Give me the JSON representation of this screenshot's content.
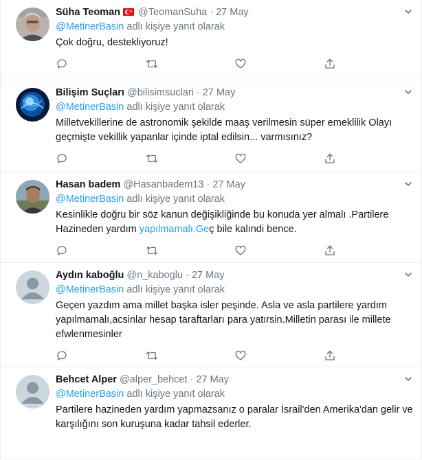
{
  "reply_prefix": "adlı kişiye yanıt olarak",
  "colors": {
    "accent": "#1da1f2",
    "muted": "#657786",
    "text": "#14171a",
    "divider": "#e6ecf0"
  },
  "actions": [
    "reply-icon",
    "retweet-icon",
    "like-icon",
    "share-icon"
  ],
  "tweets": [
    {
      "name": "Süha Teoman",
      "has_flag": true,
      "handle": "@TeomanSuha",
      "date": "27 May",
      "reply_to": "@MetinerBasin",
      "text": "Çok doğru,  destekliyoruz!",
      "avatar": "photo-man-grey"
    },
    {
      "name": "Bilişim Suçları",
      "handle": "@bilisimsuclari",
      "date": "27 May",
      "reply_to": "@MetinerBasin",
      "text": "Milletvekillerine de astronomik şekilde maaş verilmesin süper emeklilik Olayı geçmişte vekillik yapanlar içinde iptal edilsin... varmısınız?",
      "avatar": "photo-blue-brain"
    },
    {
      "name": "Hasan badem",
      "handle": "@Hasanbadem13",
      "date": "27 May",
      "reply_to": "@MetinerBasin",
      "text_before": "Kesinlikle doğru bir söz kanun değişikliğinde bu konuda yer almalı .Partilere Hazineden yardım ",
      "text_link": "yapılmamalı.Ge",
      "text_after": "ç bile kalındi bence.",
      "avatar": "photo-man-outdoor"
    },
    {
      "name": "Aydın kaboğlu",
      "handle": "@n_kaboglu",
      "date": "27 May",
      "reply_to": "@MetinerBasin",
      "text": "Geçen yazdım ama millet başka isler peşinde. Asla ve asla partilere yardım yapılmamalı,acsinlar hesap taraftarları para yatırsin.Milletin parası ile millete efwlenmesinler",
      "avatar": "default-avatar"
    },
    {
      "name": "Behcet Alper",
      "handle": "@alper_behcet",
      "date": "27 May",
      "reply_to": "@MetinerBasin",
      "text": "Partilere hazineden yardım yapmazsanız o paralar İsrail'den Amerika'dan gelir ve karşılığını son kuruşuna kadar tahsil ederler.",
      "avatar": "default-avatar"
    }
  ]
}
